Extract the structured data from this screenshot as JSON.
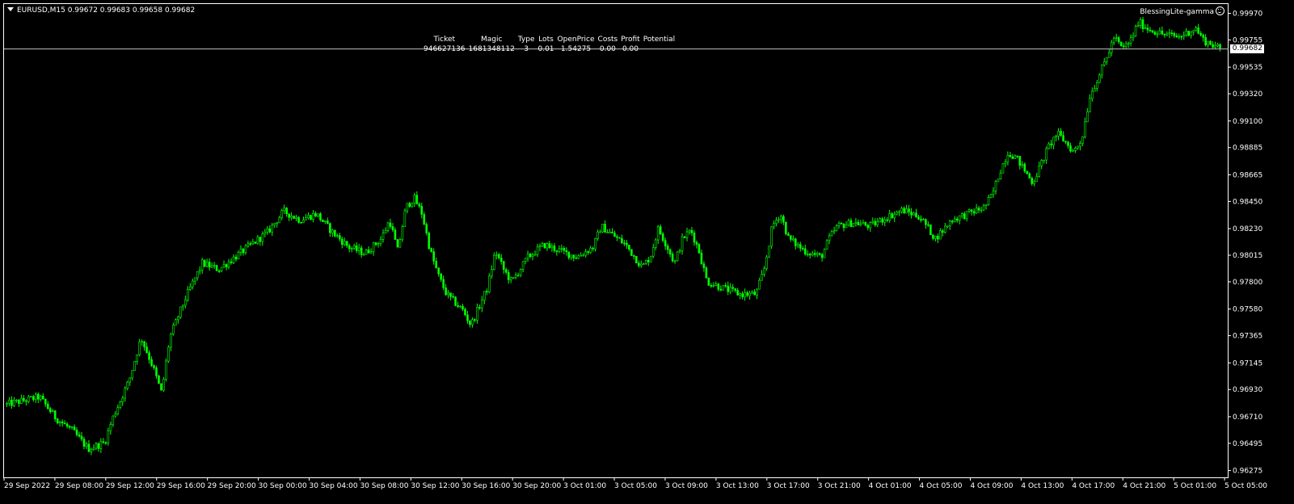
{
  "header": {
    "symbol_timeframe": "EURUSD,M15",
    "quote": "0.99672 0.99683 0.99658 0.99682"
  },
  "expert": {
    "name": "BlessingLite-gamma",
    "icon": "smiley-icon"
  },
  "trade_table": {
    "headers": [
      "Ticket",
      "Magic",
      "Type",
      "Lots",
      "OpenPrice",
      "Costs",
      "Profit",
      "Potential"
    ],
    "row": [
      "946627136",
      "1681348112",
      "3",
      "0.01",
      "1.54275",
      "0.00",
      "0.00"
    ]
  },
  "current_price": "0.99682",
  "colors": {
    "background": "#000000",
    "candle": "#00ff00",
    "foreground": "#ffffff",
    "price_line": "#c0c0c0"
  },
  "chart_data": {
    "type": "candlestick",
    "symbol": "EURUSD",
    "timeframe": "M15",
    "price_ticks": [
      "0.99970",
      "0.99755",
      "0.99535",
      "0.99320",
      "0.99100",
      "0.98885",
      "0.98665",
      "0.98450",
      "0.98230",
      "0.98015",
      "0.97800",
      "0.97580",
      "0.97365",
      "0.97145",
      "0.96930",
      "0.96710",
      "0.96495",
      "0.96275"
    ],
    "time_ticks": [
      "29 Sep 2022",
      "29 Sep 08:00",
      "29 Sep 12:00",
      "29 Sep 16:00",
      "29 Sep 20:00",
      "30 Sep 00:00",
      "30 Sep 04:00",
      "30 Sep 08:00",
      "30 Sep 12:00",
      "30 Sep 16:00",
      "30 Sep 20:00",
      "3 Oct 01:00",
      "3 Oct 05:00",
      "3 Oct 09:00",
      "3 Oct 13:00",
      "3 Oct 17:00",
      "3 Oct 21:00",
      "4 Oct 01:00",
      "4 Oct 05:00",
      "4 Oct 09:00",
      "4 Oct 13:00",
      "4 Oct 17:00",
      "4 Oct 21:00",
      "5 Oct 01:00",
      "5 Oct 05:00"
    ],
    "ylim": [
      0.9622,
      1.00045
    ],
    "close_path": [
      [
        0,
        0.9681
      ],
      [
        8,
        0.9687
      ],
      [
        12,
        0.967
      ],
      [
        16,
        0.966
      ],
      [
        20,
        0.9645
      ],
      [
        24,
        0.965
      ],
      [
        26,
        0.967
      ],
      [
        30,
        0.97
      ],
      [
        33,
        0.9735
      ],
      [
        36,
        0.971
      ],
      [
        38,
        0.969
      ],
      [
        40,
        0.9735
      ],
      [
        44,
        0.9768
      ],
      [
        48,
        0.9795
      ],
      [
        52,
        0.979
      ],
      [
        56,
        0.98
      ],
      [
        60,
        0.981
      ],
      [
        64,
        0.982
      ],
      [
        68,
        0.9837
      ],
      [
        72,
        0.983
      ],
      [
        76,
        0.9835
      ],
      [
        80,
        0.982
      ],
      [
        84,
        0.9808
      ],
      [
        88,
        0.9803
      ],
      [
        92,
        0.9815
      ],
      [
        94,
        0.983
      ],
      [
        96,
        0.9805
      ],
      [
        98,
        0.984
      ],
      [
        100,
        0.9848
      ],
      [
        102,
        0.9835
      ],
      [
        104,
        0.9805
      ],
      [
        106,
        0.9785
      ],
      [
        108,
        0.977
      ],
      [
        112,
        0.9757
      ],
      [
        114,
        0.9745
      ],
      [
        116,
        0.976
      ],
      [
        118,
        0.9775
      ],
      [
        120,
        0.9805
      ],
      [
        122,
        0.979
      ],
      [
        124,
        0.978
      ],
      [
        128,
        0.98
      ],
      [
        132,
        0.981
      ],
      [
        136,
        0.9805
      ],
      [
        140,
        0.98
      ],
      [
        144,
        0.9808
      ],
      [
        146,
        0.9825
      ],
      [
        148,
        0.982
      ],
      [
        152,
        0.981
      ],
      [
        156,
        0.9792
      ],
      [
        158,
        0.98
      ],
      [
        160,
        0.9823
      ],
      [
        162,
        0.981
      ],
      [
        164,
        0.9795
      ],
      [
        166,
        0.9815
      ],
      [
        168,
        0.9822
      ],
      [
        170,
        0.9805
      ],
      [
        172,
        0.978
      ],
      [
        176,
        0.9775
      ],
      [
        180,
        0.977
      ],
      [
        184,
        0.977
      ],
      [
        186,
        0.979
      ],
      [
        188,
        0.9825
      ],
      [
        190,
        0.9835
      ],
      [
        192,
        0.9815
      ],
      [
        196,
        0.9805
      ],
      [
        200,
        0.98
      ],
      [
        202,
        0.9815
      ],
      [
        204,
        0.9825
      ],
      [
        208,
        0.9828
      ],
      [
        212,
        0.9825
      ],
      [
        216,
        0.9832
      ],
      [
        220,
        0.9838
      ],
      [
        224,
        0.9833
      ],
      [
        226,
        0.9825
      ],
      [
        228,
        0.9815
      ],
      [
        230,
        0.9822
      ],
      [
        232,
        0.983
      ],
      [
        236,
        0.9835
      ],
      [
        240,
        0.984
      ],
      [
        242,
        0.985
      ],
      [
        244,
        0.987
      ],
      [
        246,
        0.9885
      ],
      [
        248,
        0.988
      ],
      [
        250,
        0.987
      ],
      [
        252,
        0.986
      ],
      [
        254,
        0.9875
      ],
      [
        256,
        0.989
      ],
      [
        258,
        0.99
      ],
      [
        260,
        0.9893
      ],
      [
        262,
        0.9885
      ],
      [
        264,
        0.9895
      ],
      [
        266,
        0.993
      ],
      [
        268,
        0.9945
      ],
      [
        270,
        0.996
      ],
      [
        272,
        0.9978
      ],
      [
        274,
        0.9968
      ],
      [
        276,
        0.9975
      ],
      [
        278,
        0.999
      ],
      [
        280,
        0.9985
      ],
      [
        284,
        0.998
      ],
      [
        288,
        0.9978
      ],
      [
        292,
        0.9985
      ],
      [
        294,
        0.9975
      ],
      [
        296,
        0.9972
      ],
      [
        298,
        0.9968
      ]
    ]
  }
}
